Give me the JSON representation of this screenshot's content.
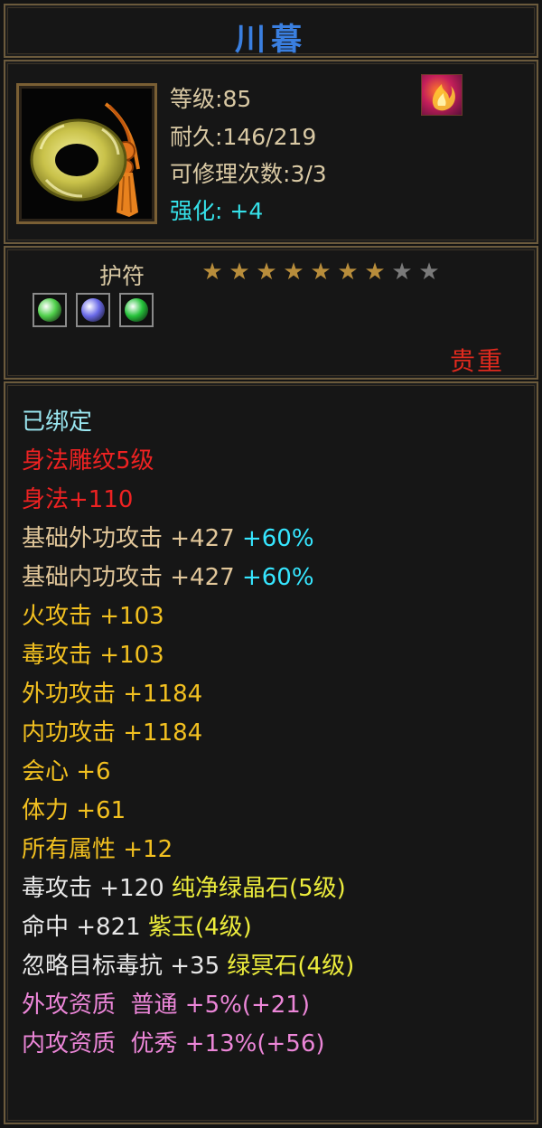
{
  "item": {
    "name": "川暮",
    "type": "护符",
    "rarity": "贵重",
    "level_label": "等级",
    "level_sep": ":",
    "level_value": "85",
    "durability_label": "耐久",
    "durability_sep": ":",
    "durability_value": "146/219",
    "repair_label": "可修理次数",
    "repair_sep": ":",
    "repair_value": "3/3",
    "enhance_label": "强化",
    "enhance_sep": ": ",
    "enhance_value": "+4",
    "stars_filled": 7,
    "stars_total": 9,
    "icon": "jade-pendant-icon",
    "badge_icon": "flame-badge-icon",
    "gem_slots": [
      {
        "icon": "green-gem-icon",
        "color": "#4fd04a"
      },
      {
        "icon": "purple-gem-icon",
        "color": "#6a6ae8"
      },
      {
        "icon": "emerald-gem-icon",
        "color": "#25c23a"
      }
    ]
  },
  "attributes": [
    {
      "text": "已绑定",
      "color": "#9ae6f0"
    },
    {
      "text": "身法雕纹5级",
      "color": "#ee2222"
    },
    {
      "text": "身法+110",
      "color": "#ee2222"
    },
    {
      "text": "基础外功攻击 +427",
      "suffix": "+60%",
      "color": "#e2c79a"
    },
    {
      "text": "基础内功攻击 +427",
      "suffix": "+60%",
      "color": "#e2c79a"
    },
    {
      "text": "火攻击 +103",
      "color": "#f2c020"
    },
    {
      "text": "毒攻击 +103",
      "color": "#f2c020"
    },
    {
      "text": "外功攻击 +1184",
      "color": "#f2c020"
    },
    {
      "text": "内功攻击 +1184",
      "color": "#f2c020"
    },
    {
      "text": "会心 +6",
      "color": "#f2c020"
    },
    {
      "text": "体力 +61",
      "color": "#f2c020"
    },
    {
      "text": "所有属性 +12",
      "color": "#f2c020"
    },
    {
      "text": "毒攻击 +120",
      "gem": "纯净绿晶石(5级)",
      "color": "#e8e8e8"
    },
    {
      "text": "命中 +821",
      "gem": "紫玉(4级)",
      "color": "#e8e8e8"
    },
    {
      "text": "忽略目标毒抗 +35",
      "gem": "绿冥石(4级)",
      "color": "#e8e8e8"
    },
    {
      "text": "外攻资质  普通 +5%(+21)",
      "color": "#ec86d8"
    },
    {
      "text": "内攻资质  优秀 +13%(+56)",
      "color": "#ec86d8"
    }
  ],
  "colors": {
    "title": "#3a7fe0",
    "border": "#6b5a3c",
    "percent_bonus": "#36e6ff",
    "gem_name": "#ecec3c"
  }
}
